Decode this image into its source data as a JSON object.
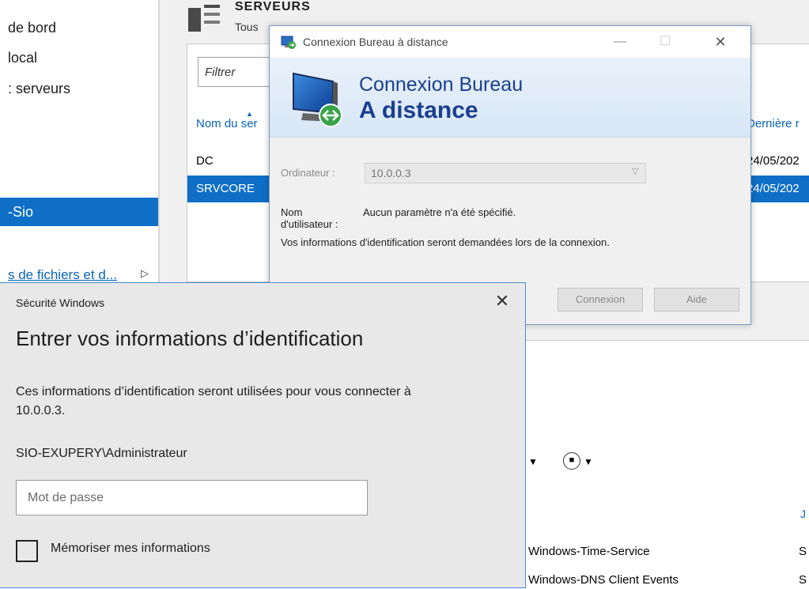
{
  "server_manager": {
    "nav_items": [
      {
        "label": "de bord"
      },
      {
        "label": "local"
      },
      {
        "label": ": serveurs"
      },
      {
        "label": "-Sio"
      },
      {
        "label": "s de fichiers et d..."
      }
    ],
    "nav_expand_arrow": "▷",
    "servers_title": "SERVEURS",
    "servers_subtitle": "Tous",
    "filter_placeholder": "Filtrer",
    "col_name": "Nom du ser",
    "col_last": "Dernière r",
    "rows": [
      {
        "name": "DC",
        "date": "24/05/202"
      },
      {
        "name": "SRVCORE",
        "date": "24/05/202"
      }
    ],
    "lower_col_header": "J",
    "events": [
      {
        "source": "Windows-Time-Service",
        "level": "S"
      },
      {
        "source": "Windows-DNS Client Events",
        "level": "S"
      }
    ]
  },
  "rdc": {
    "window_title": "Connexion Bureau à distance",
    "minimize_glyph": "—",
    "maximize_glyph": "☐",
    "close_glyph": "✕",
    "banner_line1": "Connexion Bureau",
    "banner_line2": "A distance",
    "computer_label": "Ordinateur :",
    "computer_value": "10.0.0.3",
    "username_label": "Nom d'utilisateur :",
    "username_value": "Aucun paramètre n'a été spécifié.",
    "info_text": "Vos informations d'identification seront demandées lors de la connexion.",
    "connect_button": "Connexion",
    "help_button": "Aide"
  },
  "windows_security": {
    "title": "Sécurité Windows",
    "close_glyph": "✕",
    "heading": "Entrer vos informations d’identification",
    "description": "Ces informations d’identification seront utilisées pour vous connecter à 10.0.0.3.",
    "username": "SIO-EXUPERY\\Administrateur",
    "password_placeholder": "Mot de passe",
    "remember_label": "Mémoriser mes informations"
  },
  "colors": {
    "selection_blue": "#0f6fc6",
    "link_blue": "#0a63b6",
    "rdc_title_blue": "#1b3f8f"
  }
}
